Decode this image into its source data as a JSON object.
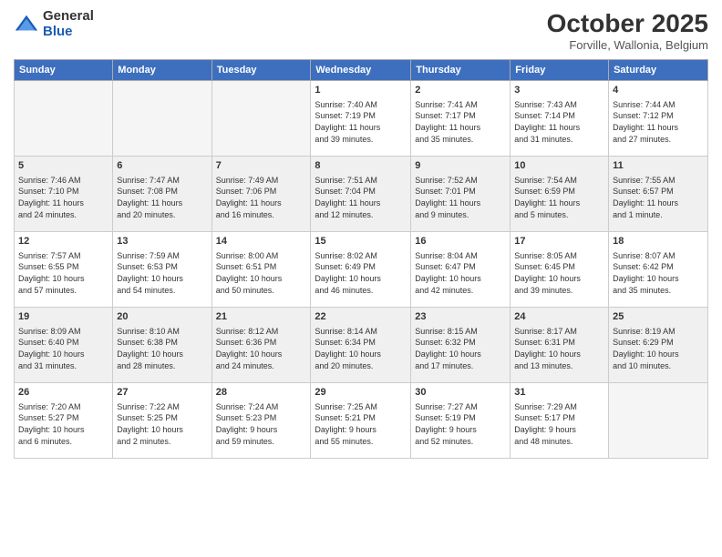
{
  "header": {
    "logo_general": "General",
    "logo_blue": "Blue",
    "month_title": "October 2025",
    "location": "Forville, Wallonia, Belgium"
  },
  "weekdays": [
    "Sunday",
    "Monday",
    "Tuesday",
    "Wednesday",
    "Thursday",
    "Friday",
    "Saturday"
  ],
  "weeks": [
    [
      {
        "day": "",
        "info": ""
      },
      {
        "day": "",
        "info": ""
      },
      {
        "day": "",
        "info": ""
      },
      {
        "day": "1",
        "info": "Sunrise: 7:40 AM\nSunset: 7:19 PM\nDaylight: 11 hours\nand 39 minutes."
      },
      {
        "day": "2",
        "info": "Sunrise: 7:41 AM\nSunset: 7:17 PM\nDaylight: 11 hours\nand 35 minutes."
      },
      {
        "day": "3",
        "info": "Sunrise: 7:43 AM\nSunset: 7:14 PM\nDaylight: 11 hours\nand 31 minutes."
      },
      {
        "day": "4",
        "info": "Sunrise: 7:44 AM\nSunset: 7:12 PM\nDaylight: 11 hours\nand 27 minutes."
      }
    ],
    [
      {
        "day": "5",
        "info": "Sunrise: 7:46 AM\nSunset: 7:10 PM\nDaylight: 11 hours\nand 24 minutes."
      },
      {
        "day": "6",
        "info": "Sunrise: 7:47 AM\nSunset: 7:08 PM\nDaylight: 11 hours\nand 20 minutes."
      },
      {
        "day": "7",
        "info": "Sunrise: 7:49 AM\nSunset: 7:06 PM\nDaylight: 11 hours\nand 16 minutes."
      },
      {
        "day": "8",
        "info": "Sunrise: 7:51 AM\nSunset: 7:04 PM\nDaylight: 11 hours\nand 12 minutes."
      },
      {
        "day": "9",
        "info": "Sunrise: 7:52 AM\nSunset: 7:01 PM\nDaylight: 11 hours\nand 9 minutes."
      },
      {
        "day": "10",
        "info": "Sunrise: 7:54 AM\nSunset: 6:59 PM\nDaylight: 11 hours\nand 5 minutes."
      },
      {
        "day": "11",
        "info": "Sunrise: 7:55 AM\nSunset: 6:57 PM\nDaylight: 11 hours\nand 1 minute."
      }
    ],
    [
      {
        "day": "12",
        "info": "Sunrise: 7:57 AM\nSunset: 6:55 PM\nDaylight: 10 hours\nand 57 minutes."
      },
      {
        "day": "13",
        "info": "Sunrise: 7:59 AM\nSunset: 6:53 PM\nDaylight: 10 hours\nand 54 minutes."
      },
      {
        "day": "14",
        "info": "Sunrise: 8:00 AM\nSunset: 6:51 PM\nDaylight: 10 hours\nand 50 minutes."
      },
      {
        "day": "15",
        "info": "Sunrise: 8:02 AM\nSunset: 6:49 PM\nDaylight: 10 hours\nand 46 minutes."
      },
      {
        "day": "16",
        "info": "Sunrise: 8:04 AM\nSunset: 6:47 PM\nDaylight: 10 hours\nand 42 minutes."
      },
      {
        "day": "17",
        "info": "Sunrise: 8:05 AM\nSunset: 6:45 PM\nDaylight: 10 hours\nand 39 minutes."
      },
      {
        "day": "18",
        "info": "Sunrise: 8:07 AM\nSunset: 6:42 PM\nDaylight: 10 hours\nand 35 minutes."
      }
    ],
    [
      {
        "day": "19",
        "info": "Sunrise: 8:09 AM\nSunset: 6:40 PM\nDaylight: 10 hours\nand 31 minutes."
      },
      {
        "day": "20",
        "info": "Sunrise: 8:10 AM\nSunset: 6:38 PM\nDaylight: 10 hours\nand 28 minutes."
      },
      {
        "day": "21",
        "info": "Sunrise: 8:12 AM\nSunset: 6:36 PM\nDaylight: 10 hours\nand 24 minutes."
      },
      {
        "day": "22",
        "info": "Sunrise: 8:14 AM\nSunset: 6:34 PM\nDaylight: 10 hours\nand 20 minutes."
      },
      {
        "day": "23",
        "info": "Sunrise: 8:15 AM\nSunset: 6:32 PM\nDaylight: 10 hours\nand 17 minutes."
      },
      {
        "day": "24",
        "info": "Sunrise: 8:17 AM\nSunset: 6:31 PM\nDaylight: 10 hours\nand 13 minutes."
      },
      {
        "day": "25",
        "info": "Sunrise: 8:19 AM\nSunset: 6:29 PM\nDaylight: 10 hours\nand 10 minutes."
      }
    ],
    [
      {
        "day": "26",
        "info": "Sunrise: 7:20 AM\nSunset: 5:27 PM\nDaylight: 10 hours\nand 6 minutes."
      },
      {
        "day": "27",
        "info": "Sunrise: 7:22 AM\nSunset: 5:25 PM\nDaylight: 10 hours\nand 2 minutes."
      },
      {
        "day": "28",
        "info": "Sunrise: 7:24 AM\nSunset: 5:23 PM\nDaylight: 9 hours\nand 59 minutes."
      },
      {
        "day": "29",
        "info": "Sunrise: 7:25 AM\nSunset: 5:21 PM\nDaylight: 9 hours\nand 55 minutes."
      },
      {
        "day": "30",
        "info": "Sunrise: 7:27 AM\nSunset: 5:19 PM\nDaylight: 9 hours\nand 52 minutes."
      },
      {
        "day": "31",
        "info": "Sunrise: 7:29 AM\nSunset: 5:17 PM\nDaylight: 9 hours\nand 48 minutes."
      },
      {
        "day": "",
        "info": ""
      }
    ]
  ]
}
